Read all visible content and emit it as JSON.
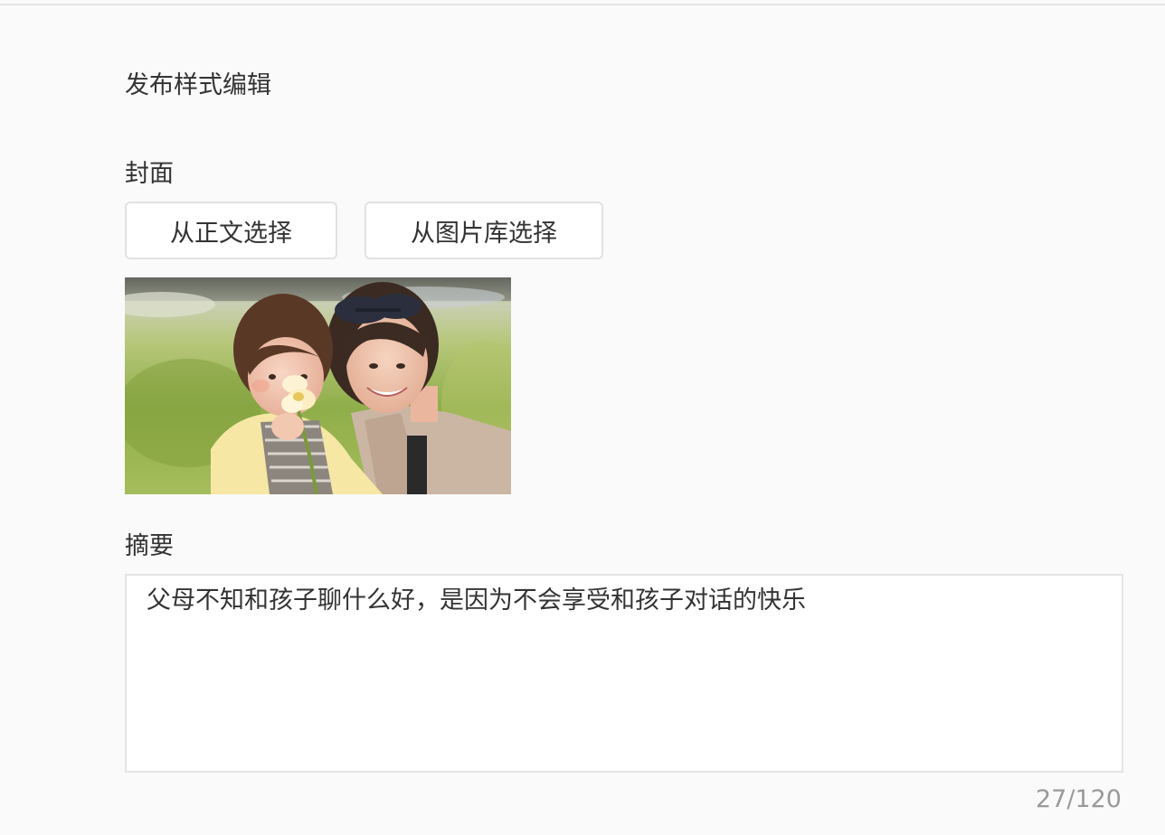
{
  "page": {
    "title": "发布样式编辑"
  },
  "cover": {
    "label": "封面",
    "buttons": {
      "from_body": "从正文选择",
      "from_library": "从图片库选择"
    },
    "image_icon": "photo-thumbnail"
  },
  "summary": {
    "label": "摘要",
    "value": "父母不知和孩子聊什么好，是因为不会享受和孩子对话的快乐",
    "counter": "27/120"
  },
  "colors": {
    "background": "#fafafa",
    "text": "#333333",
    "border": "#e4e4e4",
    "muted": "#9a9a9a"
  }
}
